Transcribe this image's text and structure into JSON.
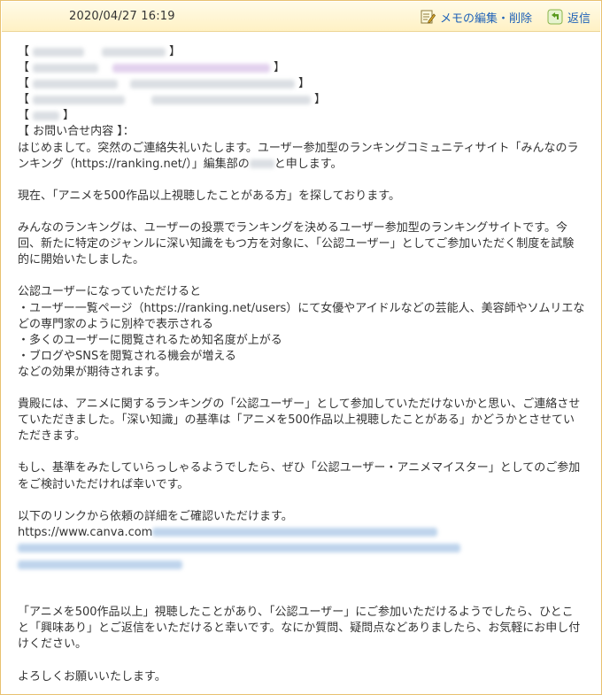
{
  "header": {
    "date": "2020/04/27 16:19",
    "edit_label": "メモの編集・削除",
    "reply_label": "返信",
    "edit_icon": "memo-edit-icon",
    "reply_icon": "reply-arrow-icon",
    "accent": "#1f62b8"
  },
  "message": {
    "fields": [
      {
        "bracket_open": "【",
        "bracket_close": "】"
      },
      {
        "bracket_open": "【",
        "bracket_close": "】"
      },
      {
        "bracket_open": "【",
        "bracket_close": "】"
      },
      {
        "bracket_open": "【",
        "bracket_close": "】"
      },
      {
        "bracket_open": "【",
        "bracket_close": "】"
      }
    ],
    "inquiry_label": "【 お問い合せ内容 】：",
    "p1a": "はじめまして。突然のご連絡失礼いたします。ユーザー参加型のランキングコミュニティサイト「みんなのラ",
    "p1b_pre": "ンキング（https://ranking.net/）」編集部の",
    "p1b_post": "と申します。",
    "p2": "現在、「アニメを500作品以上視聴したことがある方」を探しております。",
    "p3a": "みんなのランキングは、ユーザーの投票でランキングを決めるユーザー参加型のランキングサイトです。今",
    "p3b": "回、新たに特定のジャンルに深い知識をもつ方を対象に、「公認ユーザー」としてご参加いただく制度を試験",
    "p3c": "的に開始いたしました。",
    "p4a": "公認ユーザーになっていただけると",
    "p4b": "・ユーザー一覧ページ（https://ranking.net/users）にて女優やアイドルなどの芸能人、美容師やソムリエな",
    "p4c": "どの専門家のように別枠で表示される",
    "p4d": "・多くのユーザーに閲覧されるため知名度が上がる",
    "p4e": "・ブログやSNSを閲覧される機会が増える",
    "p4f": "などの効果が期待されます。",
    "p5a": "貴殿には、アニメに関するランキングの「公認ユーザー」として参加していただけないかと思い、ご連絡させ",
    "p5b": "ていただきました。「深い知識」の基準は「アニメを500作品以上視聴したことがある」かどうかとさせてい",
    "p5c": "ただきます。",
    "p6a": "もし、基準をみたしていらっしゃるようでしたら、ぜひ「公認ユーザー・アニメマイスター」としてのご参加",
    "p6b": "をご検討いただければ幸いです。",
    "p7a": "以下のリンクから依頼の詳細をご確認いただけます。",
    "p7b": "https://www.canva.com",
    "p8a": "「アニメを500作品以上」視聴したことがあり、「公認ユーザー」にご参加いただけるようでしたら、ひとこ",
    "p8b": "と「興味あり」とご返信をいただけると幸いです。なにか質問、疑問点などありましたら、お気軽にお申し付",
    "p8c": "けください。",
    "p9": "よろしくお願いいたします。"
  }
}
